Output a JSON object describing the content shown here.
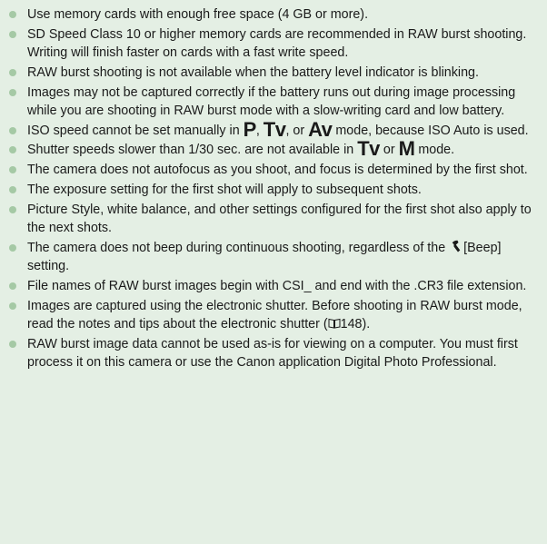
{
  "notes": [
    {
      "text": "Use memory cards with enough free space (4 GB or more)."
    },
    {
      "text": "SD Speed Class 10 or higher memory cards are recommended in RAW burst shooting. Writing will finish faster on cards with a fast write speed."
    },
    {
      "text": "RAW burst shooting is not available when the battery level indicator is blinking."
    },
    {
      "text": "Images may not be captured correctly if the battery runs out during image processing while you are shooting in RAW burst mode with a slow-writing card and low battery."
    },
    {
      "a": "ISO speed cannot be set manually in ",
      "m1": "P",
      "b": ", ",
      "m2": "Tv",
      "c": ", or ",
      "m3": "Av",
      "d": " mode, because ISO Auto is used."
    },
    {
      "a": "Shutter speeds slower than 1/30 sec. are not available in ",
      "m1": "Tv",
      "b": " or ",
      "m2": "M",
      "c": " mode."
    },
    {
      "text": "The camera does not autofocus as you shoot, and focus is determined by the first shot."
    },
    {
      "text": "The exposure setting for the first shot will apply to subsequent shots."
    },
    {
      "text": "Picture Style, white balance, and other settings configured for the first shot also apply to the next shots."
    },
    {
      "a": "The camera does not beep during continuous shooting, regardless of the ",
      "icon": "wrench-icon",
      "b": "[Beep] setting."
    },
    {
      "text": "File names of RAW burst images begin with CSI_ and end with the .CR3 file extension."
    },
    {
      "a": "Images are captured using the electronic shutter. Before shooting in RAW burst mode, read the notes and tips about the electronic shutter (",
      "icon": "book-icon",
      "b": "148)."
    },
    {
      "text": "RAW burst image data cannot be used as-is for viewing on a computer. You must first process it on this camera or use the Canon application Digital Photo Professional."
    }
  ]
}
